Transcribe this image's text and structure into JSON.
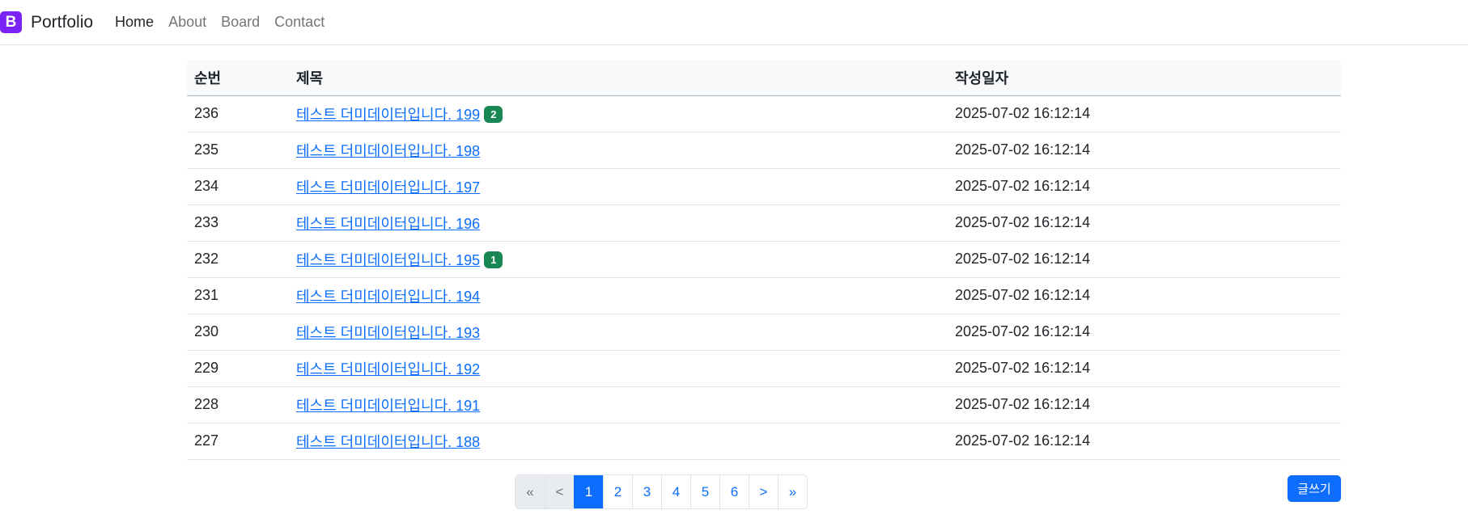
{
  "navbar": {
    "logo_letter": "B",
    "brand": "Portfolio",
    "links": [
      "Home",
      "About",
      "Board",
      "Contact"
    ]
  },
  "table": {
    "headers": [
      "순번",
      "제목",
      "작성일자"
    ],
    "rows": [
      {
        "num": "236",
        "title": "테스트 더미데이터입니다. 199",
        "badge": "2",
        "date": "2025-07-02 16:12:14"
      },
      {
        "num": "235",
        "title": "테스트 더미데이터입니다. 198",
        "badge": "",
        "date": "2025-07-02 16:12:14"
      },
      {
        "num": "234",
        "title": "테스트 더미데이터입니다. 197",
        "badge": "",
        "date": "2025-07-02 16:12:14"
      },
      {
        "num": "233",
        "title": "테스트 더미데이터입니다. 196",
        "badge": "",
        "date": "2025-07-02 16:12:14"
      },
      {
        "num": "232",
        "title": "테스트 더미데이터입니다. 195",
        "badge": "1",
        "date": "2025-07-02 16:12:14"
      },
      {
        "num": "231",
        "title": "테스트 더미데이터입니다. 194",
        "badge": "",
        "date": "2025-07-02 16:12:14"
      },
      {
        "num": "230",
        "title": "테스트 더미데이터입니다. 193",
        "badge": "",
        "date": "2025-07-02 16:12:14"
      },
      {
        "num": "229",
        "title": "테스트 더미데이터입니다. 192",
        "badge": "",
        "date": "2025-07-02 16:12:14"
      },
      {
        "num": "228",
        "title": "테스트 더미데이터입니다. 191",
        "badge": "",
        "date": "2025-07-02 16:12:14"
      },
      {
        "num": "227",
        "title": "테스트 더미데이터입니다. 188",
        "badge": "",
        "date": "2025-07-02 16:12:14"
      }
    ]
  },
  "pagination": {
    "first": "«",
    "prev": "<",
    "pages": [
      "1",
      "2",
      "3",
      "4",
      "5",
      "6"
    ],
    "current": "1",
    "next": ">",
    "last": "»"
  },
  "write_button": "글쓰기",
  "colors": {
    "primary": "#0d6efd",
    "badge": "#198754",
    "brand_logo": "#7b22f4"
  }
}
